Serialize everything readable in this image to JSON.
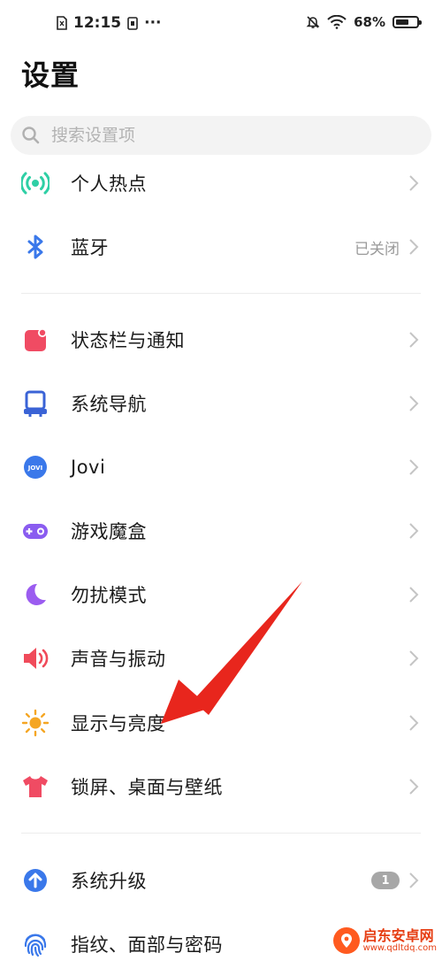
{
  "status_bar": {
    "time": "12:15",
    "more": "···",
    "battery": "68%",
    "battery_level": 0.68
  },
  "header": {
    "title": "设置"
  },
  "search": {
    "placeholder": "搜索设置项"
  },
  "items": [
    {
      "label": "个人热点",
      "icon": "hotspot-icon",
      "color": "#2ecfa5"
    },
    {
      "label": "蓝牙",
      "value": "已关闭",
      "icon": "bluetooth-icon",
      "color": "#3a78ea"
    },
    {
      "label": "状态栏与通知",
      "icon": "notification-icon",
      "color": "#f04b63"
    },
    {
      "label": "系统导航",
      "icon": "navigation-icon",
      "color": "#3a63d6"
    },
    {
      "label": "Jovi",
      "icon": "jovi-icon",
      "icon_text": "JOVI",
      "color": "#3a78ea"
    },
    {
      "label": "游戏魔盒",
      "icon": "game-box-icon",
      "color": "#8a5cf0"
    },
    {
      "label": "勿扰模式",
      "icon": "moon-icon",
      "color": "#9b5cf0"
    },
    {
      "label": "声音与振动",
      "icon": "speaker-icon",
      "color": "#f04b5a"
    },
    {
      "label": "显示与亮度",
      "icon": "sun-icon",
      "color": "#f5a623"
    },
    {
      "label": "锁屏、桌面与壁纸",
      "icon": "tshirt-icon",
      "color": "#f04b63"
    },
    {
      "label": "系统升级",
      "badge": "1",
      "icon": "upgrade-icon",
      "color": "#3a78ea"
    },
    {
      "label": "指纹、面部与密码",
      "icon": "fingerprint-icon",
      "color": "#3a78ea"
    }
  ],
  "watermark": {
    "name": "启东安卓网",
    "url": "www.qdltdq.com"
  },
  "colors": {
    "arrow": "#e8261d",
    "chevron": "#c4c4c4"
  }
}
